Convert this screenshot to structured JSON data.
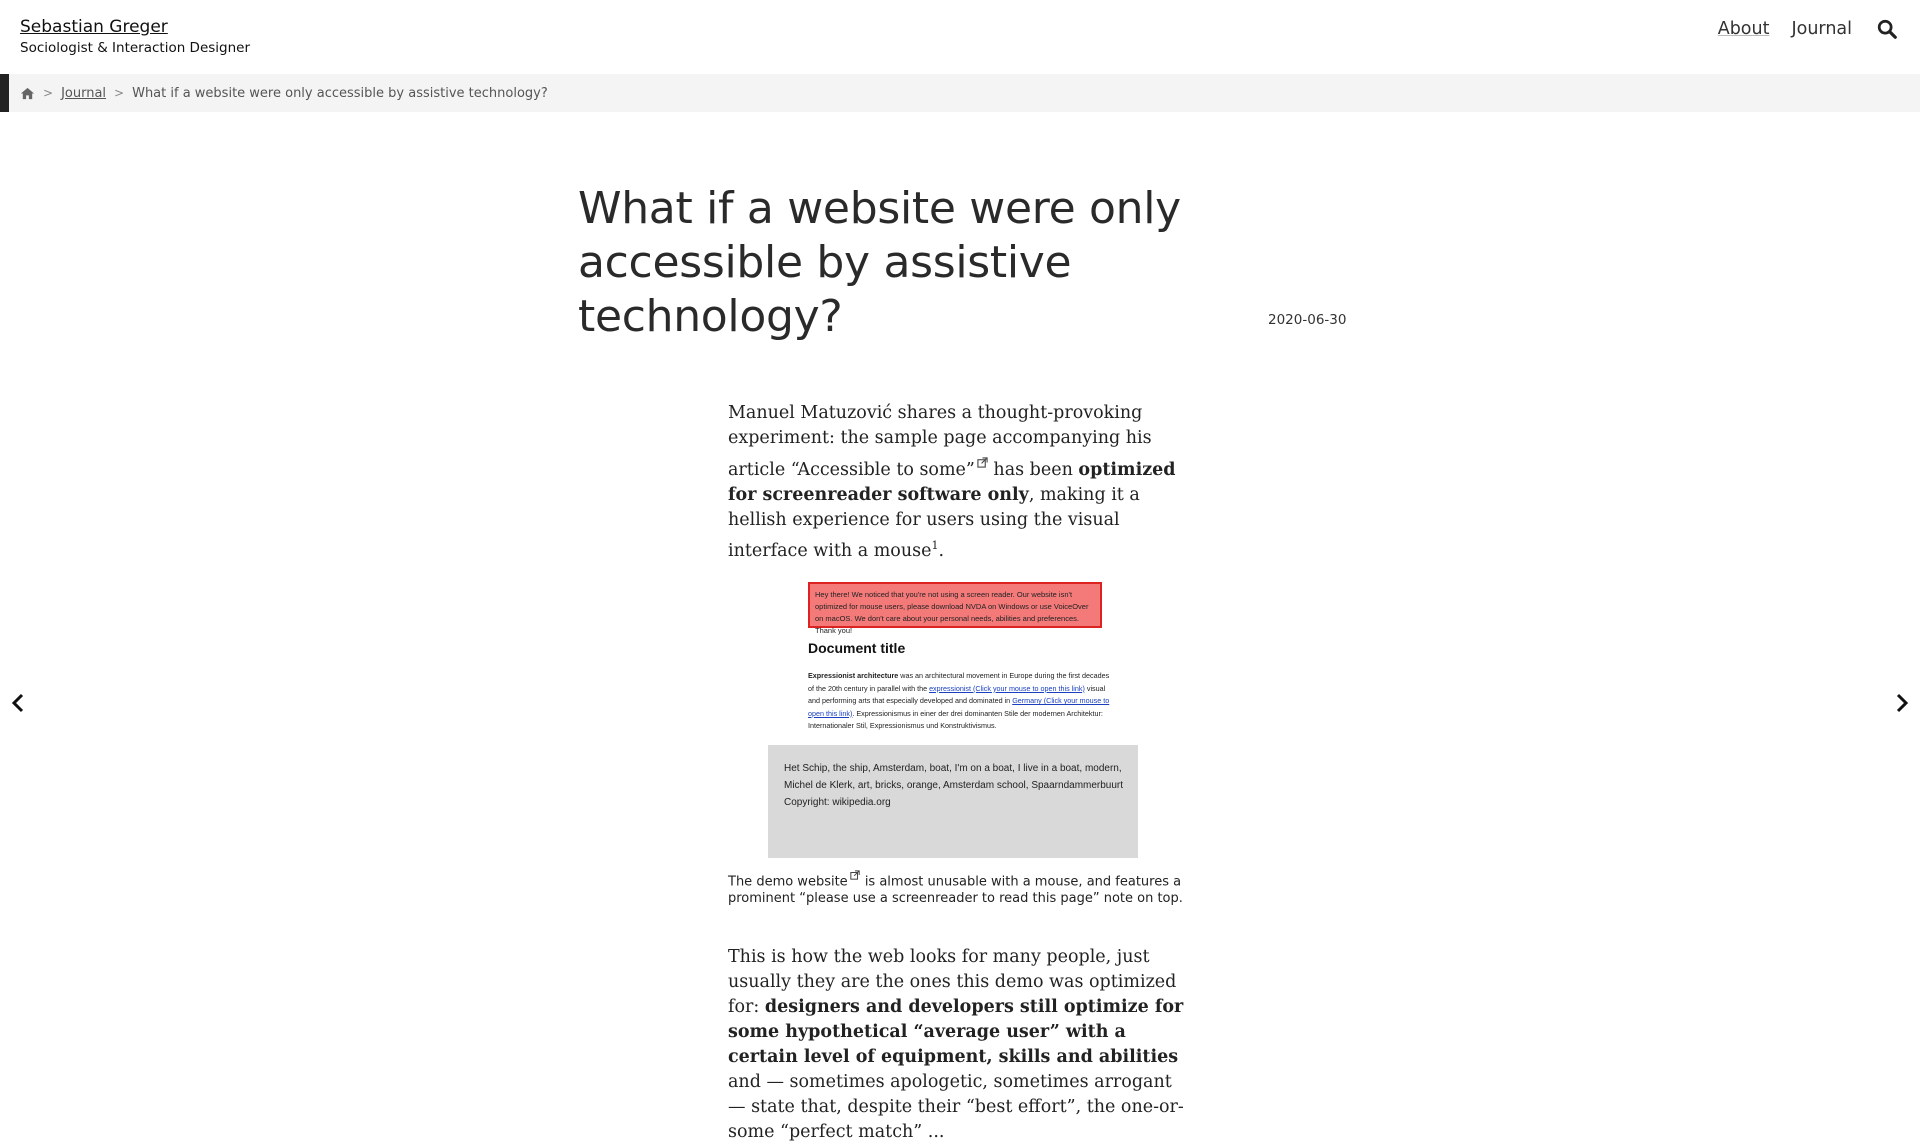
{
  "site": {
    "name": "Sebastian Greger",
    "tagline": "Sociologist & Interaction Designer"
  },
  "nav": {
    "about": "About",
    "journal": "Journal",
    "search_icon": "search-icon"
  },
  "breadcrumb": {
    "home_icon": "home-icon",
    "separator": ">",
    "journal": "Journal",
    "current": "What if a website were only accessible by assistive technology?"
  },
  "article": {
    "title": "What if a website were only accessible by assistive technology?",
    "date": "2020-06-30",
    "intro": {
      "part1": "Manuel Matuzović shares a thought-provoking experiment: the sample page accompanying his article ",
      "link": "“Accessible to some”",
      "part2": " has been ",
      "bold": "optimized for screenreader software only",
      "part3": ", making it a hellish experience for users using the visual interface with a mouse",
      "footnote": "1",
      "part4": "."
    },
    "figure": {
      "alert": "Hey there! We noticed that you're not using a screen reader. Our website isn't optimized for mouse users, please download NVDA on Windows or use VoiceOver on macOS. We don't care about your personal needs, abilities and preferences. Thank you!",
      "doc_title": "Document title",
      "doc_bold": "Expressionist architecture",
      "doc_text1": " was an architectural movement in Europe during the first decades of the 20th century in parallel with the ",
      "doc_link1": "expressionist (Click your mouse to open this link)",
      "doc_text2": " visual and performing arts that especially developed and dominated in ",
      "doc_link2": "Germany (Click your mouse to open this link)",
      "doc_text3": ". Expressionismus in einer der drei dominanten Stile der modernen Architektur: Internationaler Stil, Expressionismus und Konstruktivismus.",
      "gray_text": "Het Schip, the ship, Amsterdam, boat, I'm on a boat, I live in a boat, modern, Michel de Klerk, art, bricks, orange, Amsterdam school, Spaarndammerbuurt Copyright: wikipedia.org",
      "caption_pre": "The ",
      "caption_link": "demo website",
      "caption_post": " is almost unusable with a mouse, and features a prominent “please use a screenreader to read this page” note on top."
    },
    "para2": {
      "part1": "This is how the web looks for many people, just usually they are the ones this demo was optimized for: ",
      "bold": "designers and developers still optimize for some hypothetical “average user” with a certain level of equipment, skills and abilities",
      "part2": " and — sometimes apologetic, sometimes arrogant — state that, despite their “best effort”, the one-or-some “perfect match” ..."
    }
  },
  "pager": {
    "prev_icon": "chevron-left-icon",
    "next_icon": "chevron-right-icon"
  }
}
